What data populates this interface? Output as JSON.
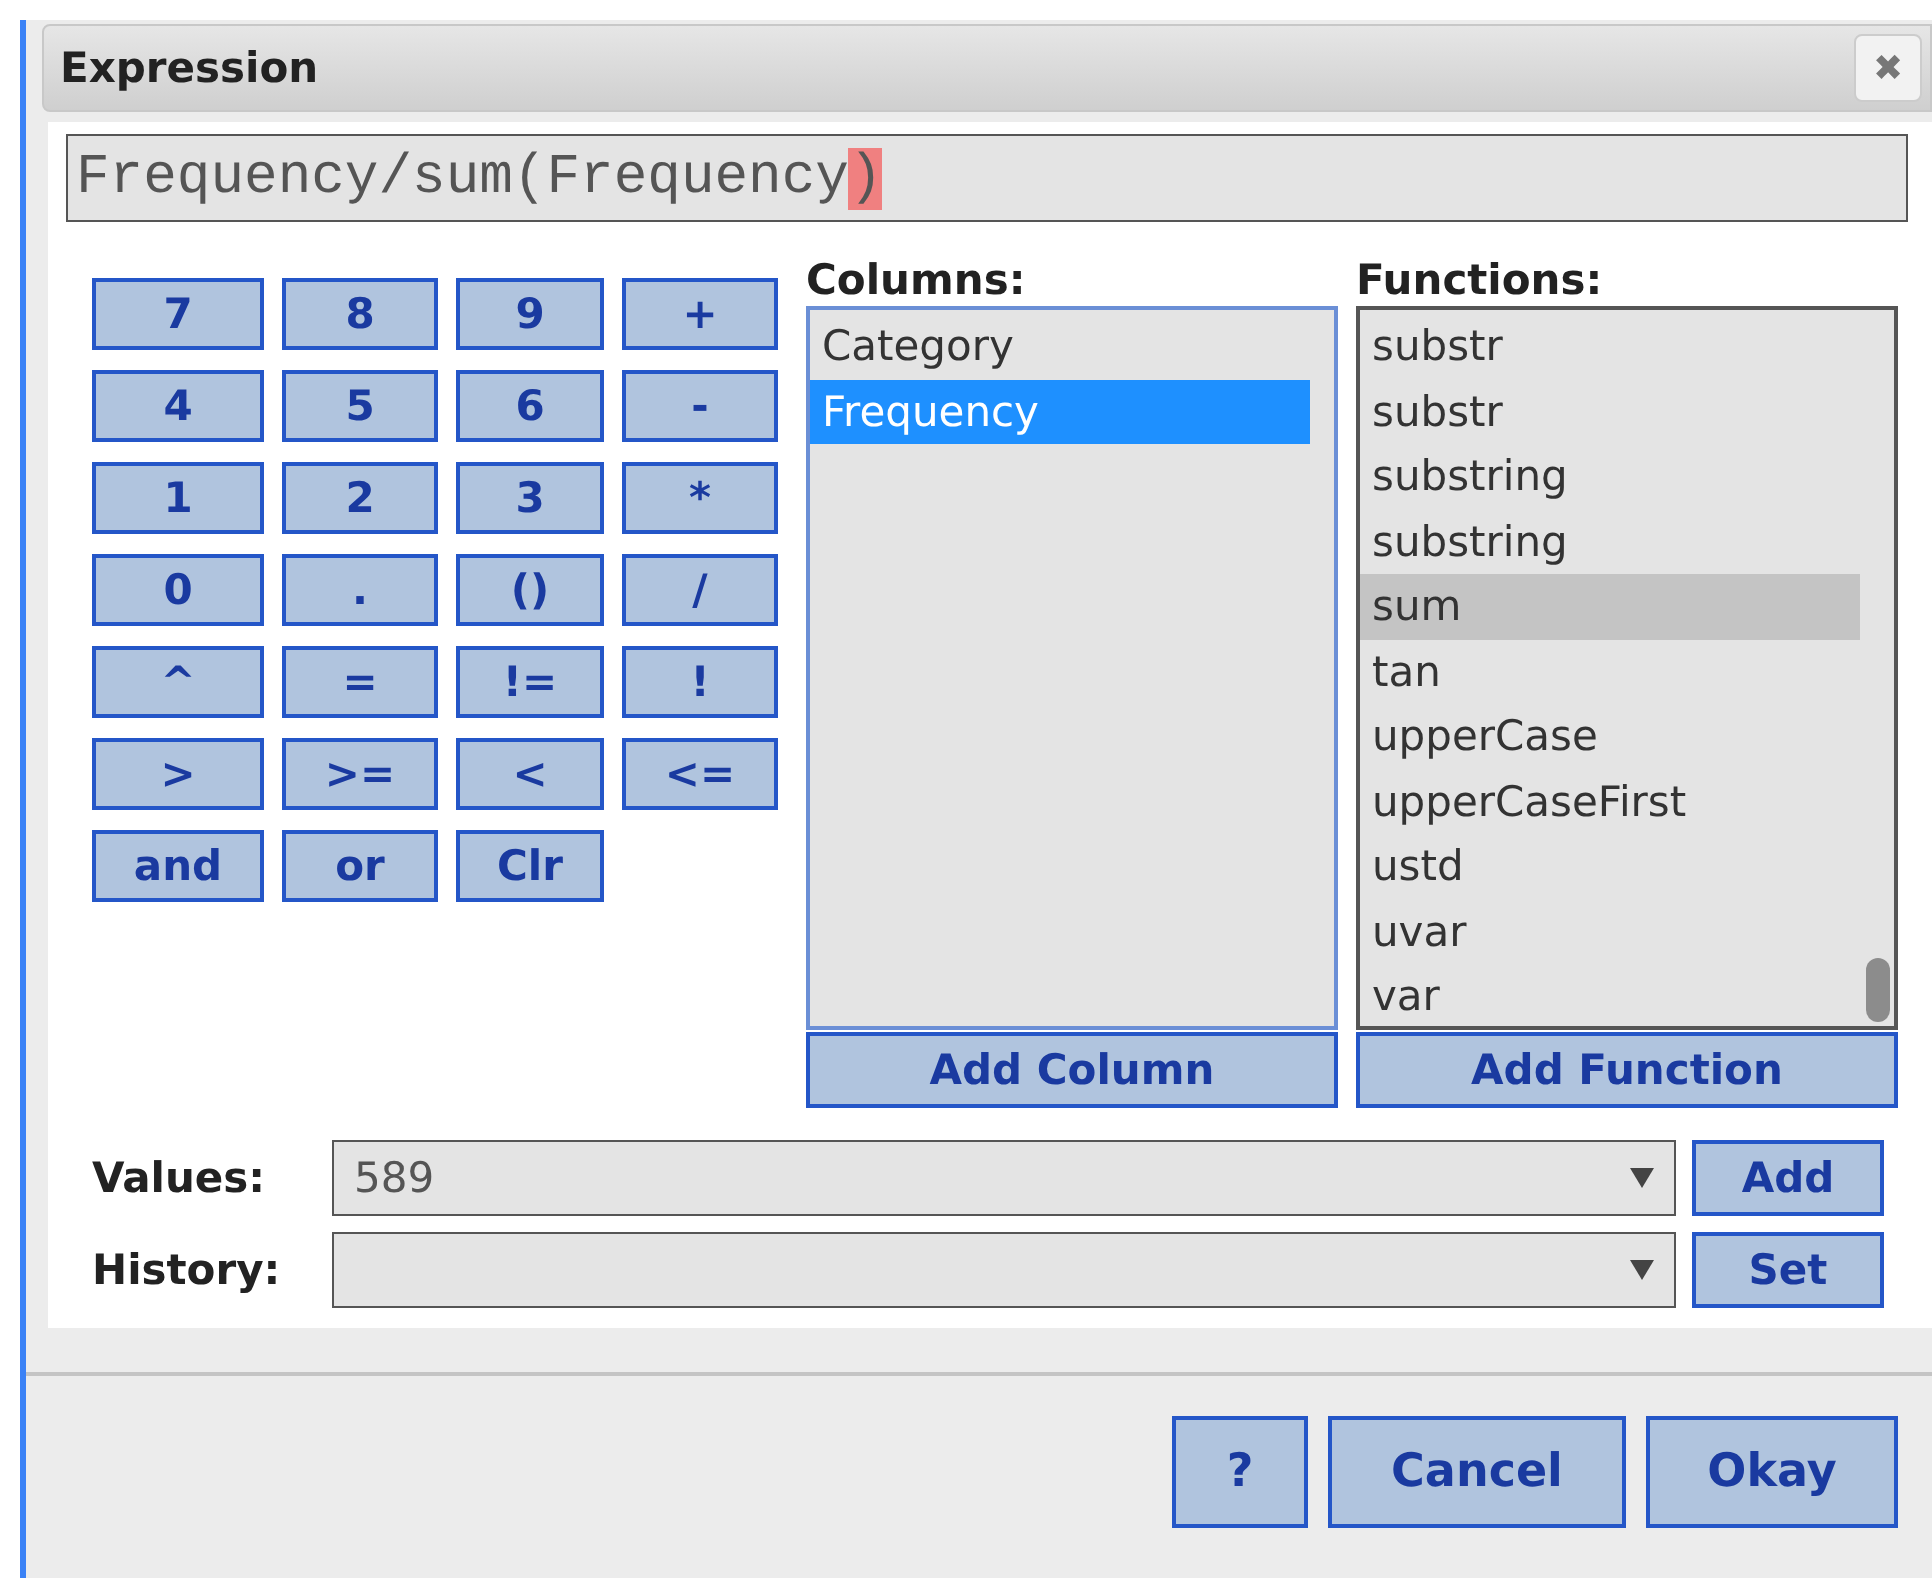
{
  "window": {
    "title": "Expression",
    "close_label": "✖"
  },
  "expression": {
    "text": "Frequency/sum(Frequency",
    "cursor_char": ")"
  },
  "keypad": [
    [
      "7",
      "8",
      "9",
      "+"
    ],
    [
      "4",
      "5",
      "6",
      "-"
    ],
    [
      "1",
      "2",
      "3",
      "*"
    ],
    [
      "0",
      ".",
      "()",
      "/"
    ],
    [
      "^",
      "=",
      "!=",
      "!"
    ],
    [
      ">",
      ">=",
      "<",
      "<="
    ],
    [
      "and",
      "or",
      "Clr"
    ]
  ],
  "columns": {
    "label": "Columns:",
    "items": [
      {
        "label": "Category",
        "selected": false
      },
      {
        "label": "Frequency",
        "selected": true
      }
    ],
    "button": "Add Column"
  },
  "functions": {
    "label": "Functions:",
    "items": [
      {
        "label": "substr",
        "selected": false
      },
      {
        "label": "substr",
        "selected": false
      },
      {
        "label": "substring",
        "selected": false
      },
      {
        "label": "substring",
        "selected": false
      },
      {
        "label": "sum",
        "selected": true
      },
      {
        "label": "tan",
        "selected": false
      },
      {
        "label": "upperCase",
        "selected": false
      },
      {
        "label": "upperCaseFirst",
        "selected": false
      },
      {
        "label": "ustd",
        "selected": false
      },
      {
        "label": "uvar",
        "selected": false
      },
      {
        "label": "var",
        "selected": false
      }
    ],
    "button": "Add Function"
  },
  "values": {
    "label": "Values:",
    "value": "589",
    "button": "Add"
  },
  "history": {
    "label": "History:",
    "button": "Set"
  },
  "footer": [
    "?",
    "Cancel",
    "Okay"
  ]
}
